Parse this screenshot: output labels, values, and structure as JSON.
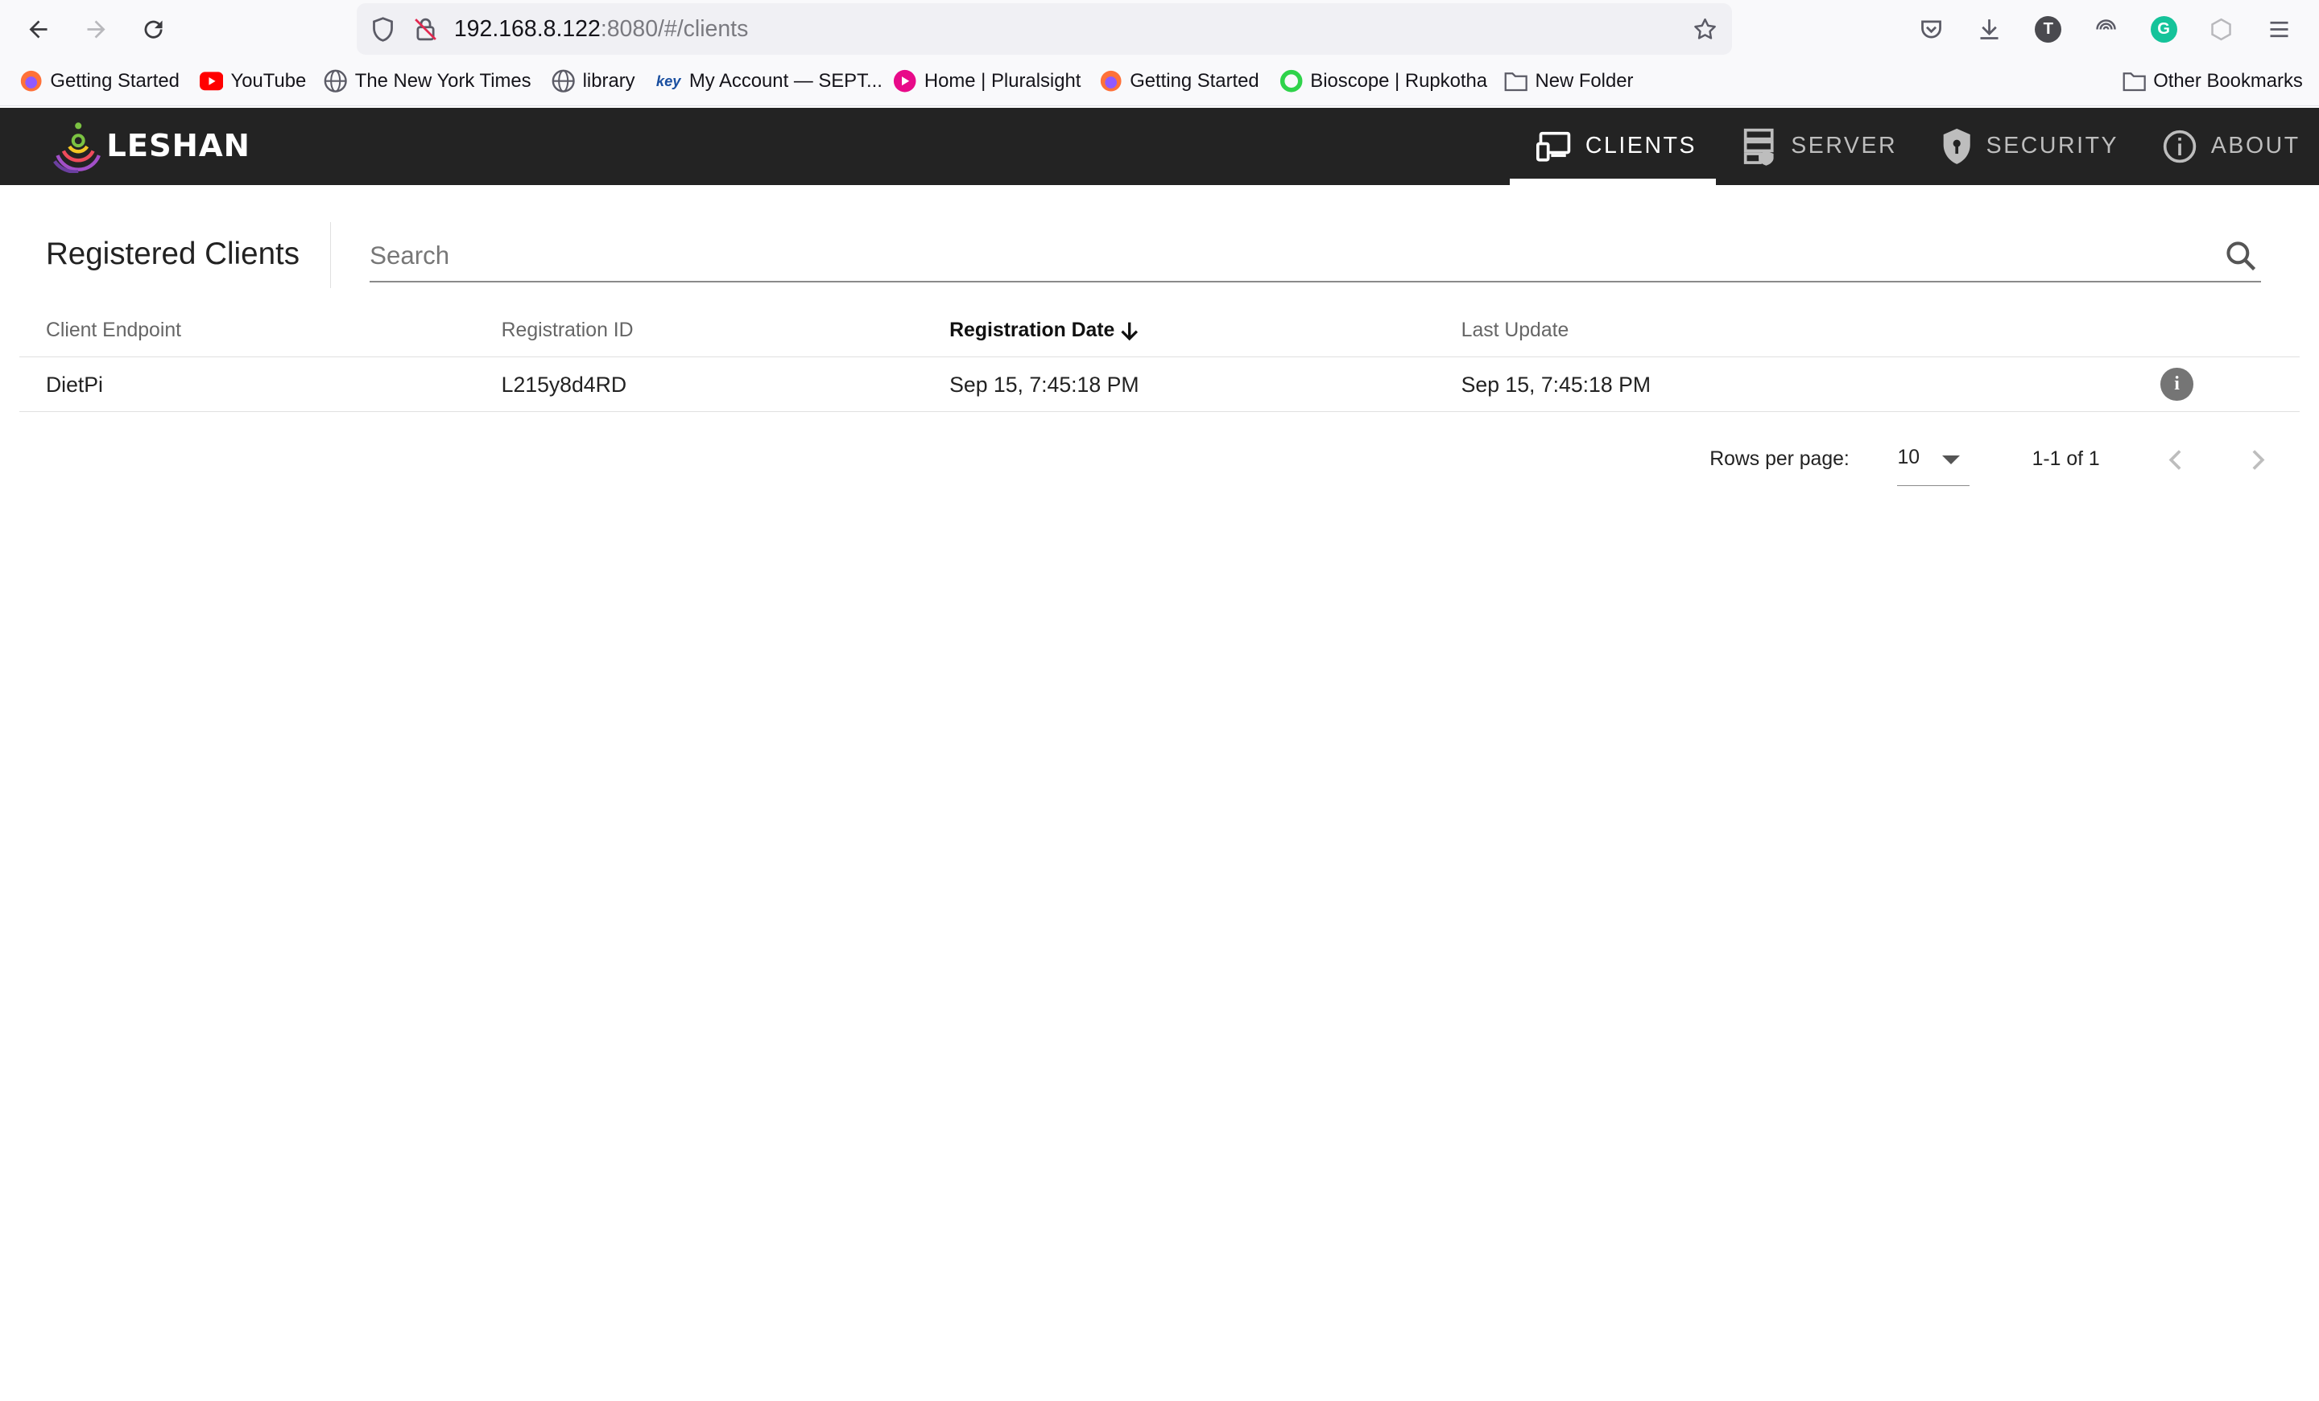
{
  "browser": {
    "url_host": "192.168.8.122",
    "url_rest": ":8080/#/clients",
    "bookmarks": [
      {
        "label": "Getting Started",
        "icon": "firefox-icon"
      },
      {
        "label": "YouTube",
        "icon": "youtube-icon"
      },
      {
        "label": "The New York Times",
        "icon": "globe-icon"
      },
      {
        "label": "library",
        "icon": "globe-icon"
      },
      {
        "label": "My Account — SEPT...",
        "icon": "key-icon"
      },
      {
        "label": "Home | Pluralsight",
        "icon": "pluralsight-icon"
      },
      {
        "label": "Getting Started",
        "icon": "firefox-icon"
      },
      {
        "label": "Bioscope | Rupkotha",
        "icon": "green-circle-icon"
      },
      {
        "label": "New Folder",
        "icon": "folder-icon"
      }
    ],
    "other_bookmarks": "Other Bookmarks",
    "profile_initial": "T",
    "grammarly_initial": "G"
  },
  "app": {
    "logo_text": "LESHAN",
    "tabs": [
      {
        "label": "CLIENTS",
        "active": true
      },
      {
        "label": "SERVER",
        "active": false
      },
      {
        "label": "SECURITY",
        "active": false
      },
      {
        "label": "ABOUT",
        "active": false
      }
    ]
  },
  "page": {
    "title": "Registered Clients",
    "search_placeholder": "Search"
  },
  "table": {
    "columns": [
      "Client Endpoint",
      "Registration ID",
      "Registration Date",
      "Last Update"
    ],
    "sorted_column": "Registration Date",
    "sort_direction": "descending",
    "rows": [
      {
        "endpoint": "DietPi",
        "registration_id": "L215y8d4RD",
        "registration_date": "Sep 15, 7:45:18 PM",
        "last_update": "Sep 15, 7:45:18 PM"
      }
    ]
  },
  "pagination": {
    "rows_per_page_label": "Rows per page:",
    "rows_per_page": "10",
    "range": "1-1 of 1"
  },
  "colors": {
    "appbar": "#232323",
    "browser_chrome": "#f9f9fb",
    "urlbar": "#f0f0f4"
  }
}
